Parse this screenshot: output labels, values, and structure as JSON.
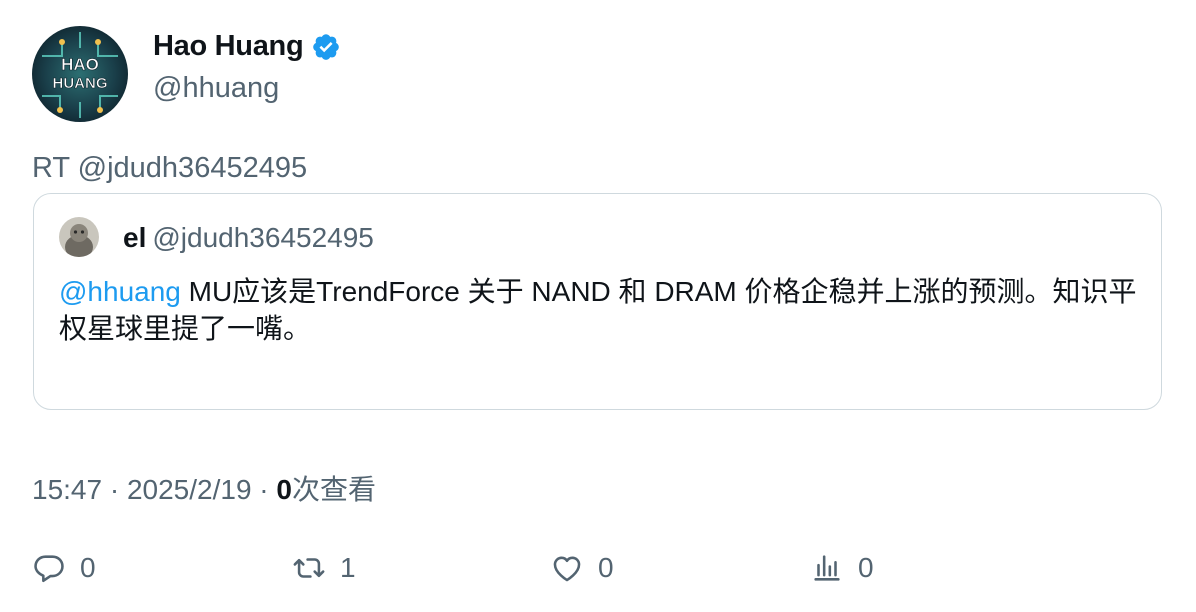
{
  "tweet": {
    "author_name": "Hao Huang",
    "author_handle": "@hhuang",
    "avatar_text_line1": "HAO",
    "avatar_text_line2": "HUANG",
    "retweet_line": "RT @jdudh36452495",
    "timestamp": "15:47 · 2025/2/19 · ",
    "views_count": "0",
    "views_label": "次查看"
  },
  "quoted": {
    "name": "el",
    "handle": "@jdudh36452495",
    "mention": "@hhuang",
    "text": " MU应该是TrendForce 关于 NAND 和 DRAM 价格企稳并上涨的预测。知识平权星球里提了一嘴。"
  },
  "actions": {
    "replies": "0",
    "retweets": "1",
    "likes": "0",
    "views": "0"
  },
  "colors": {
    "secondary_text": "#536471",
    "link": "#1d9bf0",
    "verified_badge": "#1d9bf0",
    "card_border": "#cfd9de"
  },
  "icons": [
    "verified-badge-icon",
    "reply-icon",
    "retweet-icon",
    "like-icon",
    "views-icon"
  ]
}
